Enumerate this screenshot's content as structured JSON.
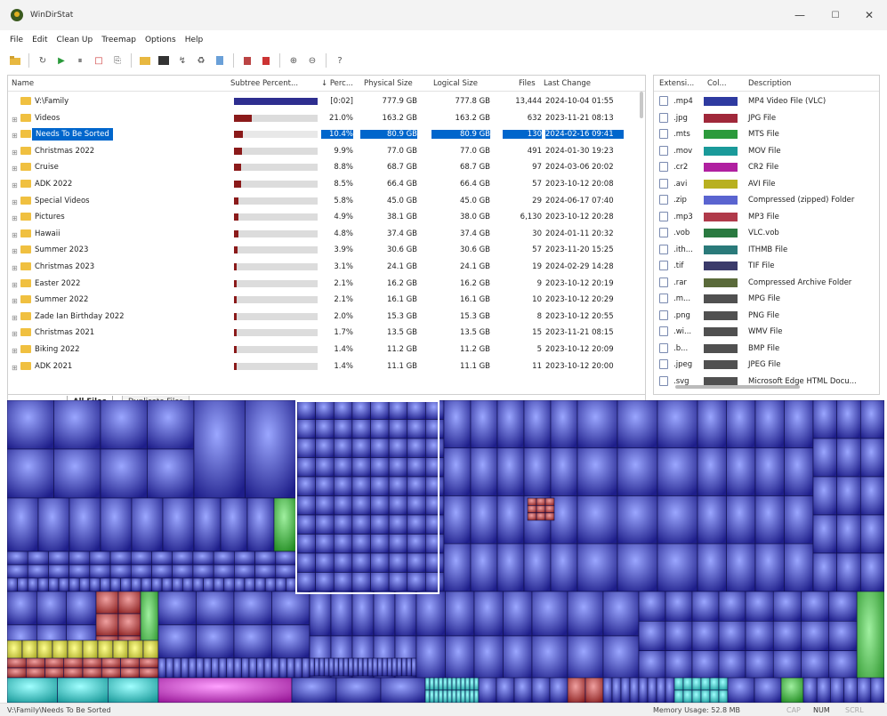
{
  "window": {
    "title": "WinDirStat",
    "min": "—",
    "max": "☐",
    "close": "✕"
  },
  "menu": [
    "File",
    "Edit",
    "Clean Up",
    "Treemap",
    "Options",
    "Help"
  ],
  "toolbar": [
    "open-icon",
    "refresh-icon",
    "play-icon",
    "pause-icon",
    "stop-icon",
    "copy-path-icon",
    "explorer-icon",
    "command-prompt-icon",
    "refresh-selected-icon",
    "delete-recycle-icon",
    "delete-icon",
    "properties-icon",
    "empty-recycle-icon",
    "cleanup-icon",
    "zoom-in-icon",
    "zoom-out-icon",
    "help-icon"
  ],
  "tree": {
    "headers": [
      "Name",
      "Subtree Percent...",
      "↓ Perc...",
      "Physical Size",
      "Logical Size",
      "Files",
      "Last Change"
    ],
    "rows": [
      {
        "name": "V:\\Family",
        "fill": 1.0,
        "bar": "#2e2e8f",
        "perc": "[0:02]",
        "phys": "777.9 GB",
        "log": "777.8 GB",
        "files": "13,444",
        "date": "2024-10-04 01:55",
        "sel": false,
        "root": true
      },
      {
        "name": "Videos",
        "fill": 0.21,
        "bar": "#8b1a1a",
        "perc": "21.0%",
        "phys": "163.2 GB",
        "log": "163.2 GB",
        "files": "632",
        "date": "2023-11-21 08:13",
        "sel": false
      },
      {
        "name": "Needs To Be Sorted",
        "fill": 0.104,
        "bar": "#8b1a1a",
        "perc": "10.4%",
        "phys": "80.9 GB",
        "log": "80.9 GB",
        "files": "130",
        "date": "2024-02-16 09:41",
        "sel": true
      },
      {
        "name": "Christmas 2022",
        "fill": 0.099,
        "bar": "#8b1a1a",
        "perc": "9.9%",
        "phys": "77.0 GB",
        "log": "77.0 GB",
        "files": "491",
        "date": "2024-01-30 19:23",
        "sel": false
      },
      {
        "name": "Cruise",
        "fill": 0.088,
        "bar": "#8b1a1a",
        "perc": "8.8%",
        "phys": "68.7 GB",
        "log": "68.7 GB",
        "files": "97",
        "date": "2024-03-06 20:02",
        "sel": false
      },
      {
        "name": "ADK 2022",
        "fill": 0.085,
        "bar": "#8b1a1a",
        "perc": "8.5%",
        "phys": "66.4 GB",
        "log": "66.4 GB",
        "files": "57",
        "date": "2023-10-12 20:08",
        "sel": false
      },
      {
        "name": "Special Videos",
        "fill": 0.058,
        "bar": "#8b1a1a",
        "perc": "5.8%",
        "phys": "45.0 GB",
        "log": "45.0 GB",
        "files": "29",
        "date": "2024-06-17 07:40",
        "sel": false
      },
      {
        "name": "Pictures",
        "fill": 0.049,
        "bar": "#8b1a1a",
        "perc": "4.9%",
        "phys": "38.1 GB",
        "log": "38.0 GB",
        "files": "6,130",
        "date": "2023-10-12 20:28",
        "sel": false
      },
      {
        "name": "Hawaii",
        "fill": 0.048,
        "bar": "#8b1a1a",
        "perc": "4.8%",
        "phys": "37.4 GB",
        "log": "37.4 GB",
        "files": "30",
        "date": "2024-01-11 20:32",
        "sel": false
      },
      {
        "name": "Summer 2023",
        "fill": 0.039,
        "bar": "#8b1a1a",
        "perc": "3.9%",
        "phys": "30.6 GB",
        "log": "30.6 GB",
        "files": "57",
        "date": "2023-11-20 15:25",
        "sel": false
      },
      {
        "name": "Christmas 2023",
        "fill": 0.031,
        "bar": "#8b1a1a",
        "perc": "3.1%",
        "phys": "24.1 GB",
        "log": "24.1 GB",
        "files": "19",
        "date": "2024-02-29 14:28",
        "sel": false
      },
      {
        "name": "Easter 2022",
        "fill": 0.021,
        "bar": "#8b1a1a",
        "perc": "2.1%",
        "phys": "16.2 GB",
        "log": "16.2 GB",
        "files": "9",
        "date": "2023-10-12 20:19",
        "sel": false
      },
      {
        "name": "Summer 2022",
        "fill": 0.021,
        "bar": "#8b1a1a",
        "perc": "2.1%",
        "phys": "16.1 GB",
        "log": "16.1 GB",
        "files": "10",
        "date": "2023-10-12 20:29",
        "sel": false
      },
      {
        "name": "Zade Ian Birthday 2022",
        "fill": 0.02,
        "bar": "#8b1a1a",
        "perc": "2.0%",
        "phys": "15.3 GB",
        "log": "15.3 GB",
        "files": "8",
        "date": "2023-10-12 20:55",
        "sel": false
      },
      {
        "name": "Christmas 2021",
        "fill": 0.017,
        "bar": "#8b1a1a",
        "perc": "1.7%",
        "phys": "13.5 GB",
        "log": "13.5 GB",
        "files": "15",
        "date": "2023-11-21 08:15",
        "sel": false
      },
      {
        "name": "Biking 2022",
        "fill": 0.014,
        "bar": "#8b1a1a",
        "perc": "1.4%",
        "phys": "11.2 GB",
        "log": "11.2 GB",
        "files": "5",
        "date": "2023-10-12 20:09",
        "sel": false
      },
      {
        "name": "ADK 2021",
        "fill": 0.014,
        "bar": "#8b1a1a",
        "perc": "1.4%",
        "phys": "11.1 GB",
        "log": "11.1 GB",
        "files": "11",
        "date": "2023-10-12 20:00",
        "sel": false
      }
    ]
  },
  "tabs": {
    "nav": [
      "⏮",
      "◀",
      "▶",
      "⏭"
    ],
    "all": "All Files",
    "dup": "Duplicate Files"
  },
  "extensions": {
    "headers": [
      "Extensi...",
      "Col...",
      "Description"
    ],
    "rows": [
      {
        "ext": ".mp4",
        "color": "#2e3aa0",
        "desc": "MP4 Video File (VLC)"
      },
      {
        "ext": ".jpg",
        "color": "#a0283a",
        "desc": "JPG File"
      },
      {
        "ext": ".mts",
        "color": "#2c9a3c",
        "desc": "MTS File"
      },
      {
        "ext": ".mov",
        "color": "#1a9a9a",
        "desc": "MOV File"
      },
      {
        "ext": ".cr2",
        "color": "#b020a0",
        "desc": "CR2 File"
      },
      {
        "ext": ".avi",
        "color": "#b8b020",
        "desc": "AVI File"
      },
      {
        "ext": ".zip",
        "color": "#5a64d0",
        "desc": "Compressed (zipped) Folder"
      },
      {
        "ext": ".mp3",
        "color": "#b03a4a",
        "desc": "MP3 File"
      },
      {
        "ext": ".vob",
        "color": "#2a7a40",
        "desc": "VLC.vob"
      },
      {
        "ext": ".ith...",
        "color": "#2a7a7a",
        "desc": "ITHMB File"
      },
      {
        "ext": ".tif",
        "color": "#3a3a6a",
        "desc": "TIF File"
      },
      {
        "ext": ".rar",
        "color": "#5a6a3a",
        "desc": "Compressed Archive Folder"
      },
      {
        "ext": ".m...",
        "color": "#505050",
        "desc": "MPG File"
      },
      {
        "ext": ".png",
        "color": "#505050",
        "desc": "PNG File"
      },
      {
        "ext": ".wi...",
        "color": "#505050",
        "desc": "WMV File"
      },
      {
        "ext": ".b...",
        "color": "#505050",
        "desc": "BMP File"
      },
      {
        "ext": ".jpeg",
        "color": "#505050",
        "desc": "JPEG File"
      },
      {
        "ext": ".svg",
        "color": "#505050",
        "desc": "Microsoft Edge HTML Docu..."
      }
    ]
  },
  "status": {
    "path": "V:\\Family\\Needs To Be Sorted",
    "memory": "Memory Usage: 52.8 MB",
    "cap": "CAP",
    "num": "NUM",
    "scrl": "SCRL"
  }
}
